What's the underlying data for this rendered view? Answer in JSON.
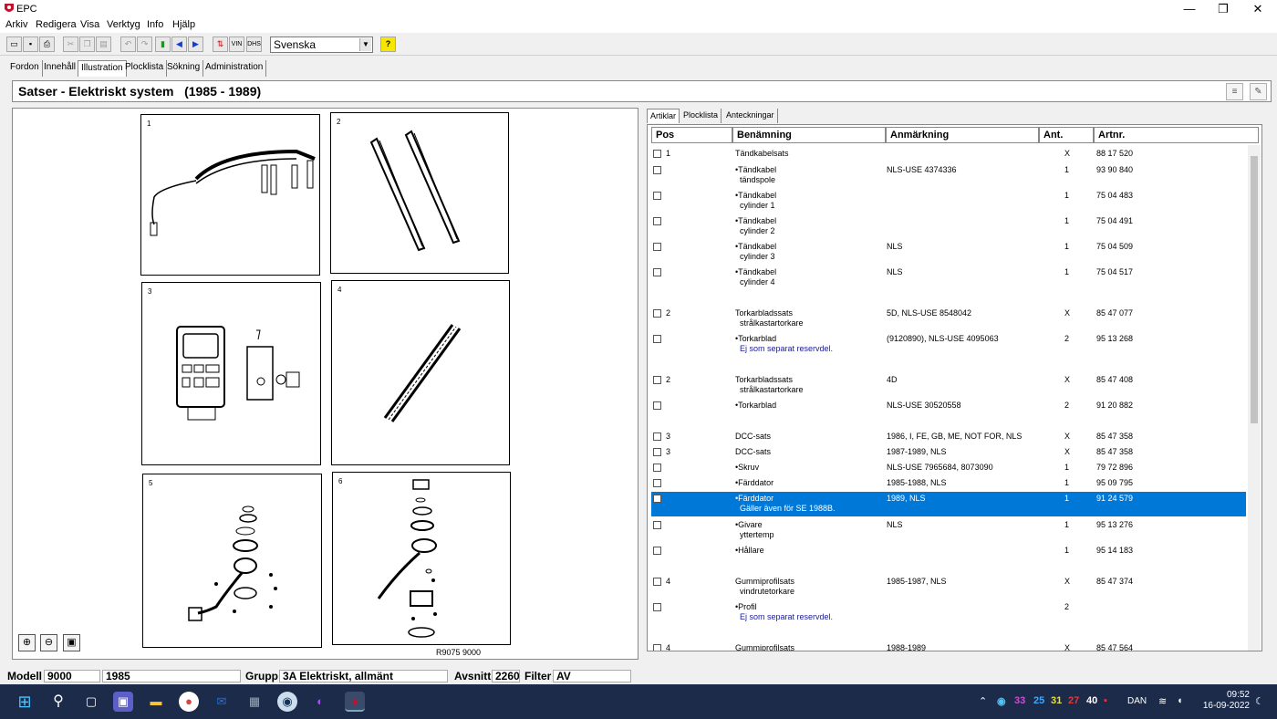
{
  "window": {
    "title": "EPC",
    "controls": [
      "—",
      "❐",
      "✕"
    ]
  },
  "menu": [
    "Arkiv",
    "Redigera",
    "Visa",
    "Verktyg",
    "Info",
    "Hjälp"
  ],
  "toolbar": {
    "language": "Svenska",
    "vin_label": "VIN",
    "help_label": "?"
  },
  "tabs": [
    "Fordon",
    "Innehåll",
    "Illustration",
    "Plocklista",
    "Sökning",
    "Administration"
  ],
  "active_tab": "Illustration",
  "header": {
    "title": "Satser - Elektriskt system   (1985 - 1989)"
  },
  "illustration": {
    "panel_numbers": [
      "1",
      "2",
      "3",
      "4",
      "5",
      "6"
    ],
    "figure_ref": "R9075 9000",
    "zoom_buttons": [
      "zoom-in",
      "zoom-out",
      "zoom-fit"
    ]
  },
  "right_tabs": [
    "Artiklar",
    "Plocklista",
    "Anteckningar"
  ],
  "grid": {
    "columns": [
      "Pos",
      "Benämning",
      "Anmärkning",
      "Ant.",
      "Artnr."
    ],
    "rows": [
      {
        "pos": "1",
        "name": "Tändkabelsats",
        "name2": "",
        "note": "",
        "remark": "",
        "qty": "X",
        "art": "88 17 520",
        "sel": false
      },
      {
        "pos": "",
        "name": "•Tändkabel",
        "name2": "tändspole",
        "note": "",
        "remark": "NLS-USE 4374336",
        "qty": "1",
        "art": "93 90 840",
        "sel": false
      },
      {
        "pos": "",
        "name": "•Tändkabel",
        "name2": "cylinder 1",
        "note": "",
        "remark": "",
        "qty": "1",
        "art": "75 04 483",
        "sel": false
      },
      {
        "pos": "",
        "name": "•Tändkabel",
        "name2": "cylinder 2",
        "note": "",
        "remark": "",
        "qty": "1",
        "art": "75 04 491",
        "sel": false
      },
      {
        "pos": "",
        "name": "•Tändkabel",
        "name2": "cylinder 3",
        "note": "",
        "remark": "NLS",
        "qty": "1",
        "art": "75 04 509",
        "sel": false
      },
      {
        "pos": "",
        "name": "•Tändkabel",
        "name2": "cylinder 4",
        "note": "",
        "remark": "NLS",
        "qty": "1",
        "art": "75 04 517",
        "sel": false
      },
      {
        "pos": "2",
        "name": "Torkarbladssats",
        "name2": "strålkastartorkare",
        "note": "",
        "remark": "5D, NLS-USE 8548042",
        "qty": "X",
        "art": "85 47 077",
        "sel": false
      },
      {
        "pos": "",
        "name": "•Torkarblad",
        "name2": "",
        "note": "Ej som separat reservdel.",
        "remark": "(9120890), NLS-USE 4095063",
        "qty": "2",
        "art": "95 13 268",
        "sel": false
      },
      {
        "pos": "2",
        "name": "Torkarbladssats",
        "name2": "strålkastartorkare",
        "note": "",
        "remark": "4D",
        "qty": "X",
        "art": "85 47 408",
        "sel": false
      },
      {
        "pos": "",
        "name": "•Torkarblad",
        "name2": "",
        "note": "",
        "remark": "NLS-USE 30520558",
        "qty": "2",
        "art": "91 20 882",
        "sel": false
      },
      {
        "pos": "3",
        "name": "DCC-sats",
        "name2": "",
        "note": "",
        "remark": "1986, I, FE, GB, ME, NOT FOR, NLS",
        "qty": "X",
        "art": "85 47 358",
        "sel": false
      },
      {
        "pos": "3",
        "name": "DCC-sats",
        "name2": "",
        "note": "",
        "remark": "1987-1989, NLS",
        "qty": "X",
        "art": "85 47 358",
        "sel": false
      },
      {
        "pos": "",
        "name": "•Skruv",
        "name2": "",
        "note": "",
        "remark": "NLS-USE 7965684, 8073090",
        "qty": "1",
        "art": "79 72 896",
        "sel": false
      },
      {
        "pos": "",
        "name": "•Färddator",
        "name2": "",
        "note": "",
        "remark": "1985-1988, NLS",
        "qty": "1",
        "art": "95 09 795",
        "sel": false
      },
      {
        "pos": "",
        "name": "•Färddator",
        "name2": "",
        "note": "Gäller även för SE 1988B.",
        "remark": "1989, NLS",
        "qty": "1",
        "art": "91 24 579",
        "sel": true
      },
      {
        "pos": "",
        "name": "•Givare",
        "name2": "yttertemp",
        "note": "",
        "remark": "NLS",
        "qty": "1",
        "art": "95 13 276",
        "sel": false
      },
      {
        "pos": "",
        "name": "•Hållare",
        "name2": "",
        "note": "",
        "remark": "",
        "qty": "1",
        "art": "95 14 183",
        "sel": false
      },
      {
        "pos": "4",
        "name": "Gummiprofilsats",
        "name2": "vindrutetorkare",
        "note": "",
        "remark": "1985-1987, NLS",
        "qty": "X",
        "art": "85 47 374",
        "sel": false
      },
      {
        "pos": "",
        "name": "•Profil",
        "name2": "",
        "note": "Ej som separat reservdel.",
        "remark": "",
        "qty": "2",
        "art": "",
        "sel": false
      },
      {
        "pos": "4",
        "name": "Gummiprofilsats",
        "name2": "",
        "note": "",
        "remark": "1988-1989",
        "qty": "X",
        "art": "85 47 564",
        "sel": false
      }
    ]
  },
  "status": {
    "modell_label": "Modell",
    "modell": "9000",
    "year": "1985",
    "grupp_label": "Grupp",
    "grupp": "3A Elektriskt, allmänt",
    "avsnitt_label": "Avsnitt",
    "avsnitt": "2260",
    "filter_label": "Filter",
    "filter": "AV"
  },
  "taskbar": {
    "tray_numbers": [
      "33",
      "25",
      "31",
      "27",
      "40"
    ],
    "tray_colors": [
      "#d14bd1",
      "#3fa7ff",
      "#e8e03a",
      "#e03a3a",
      "#ffffff"
    ],
    "lang": "DAN",
    "time": "09:52",
    "date": "16-09-2022"
  }
}
